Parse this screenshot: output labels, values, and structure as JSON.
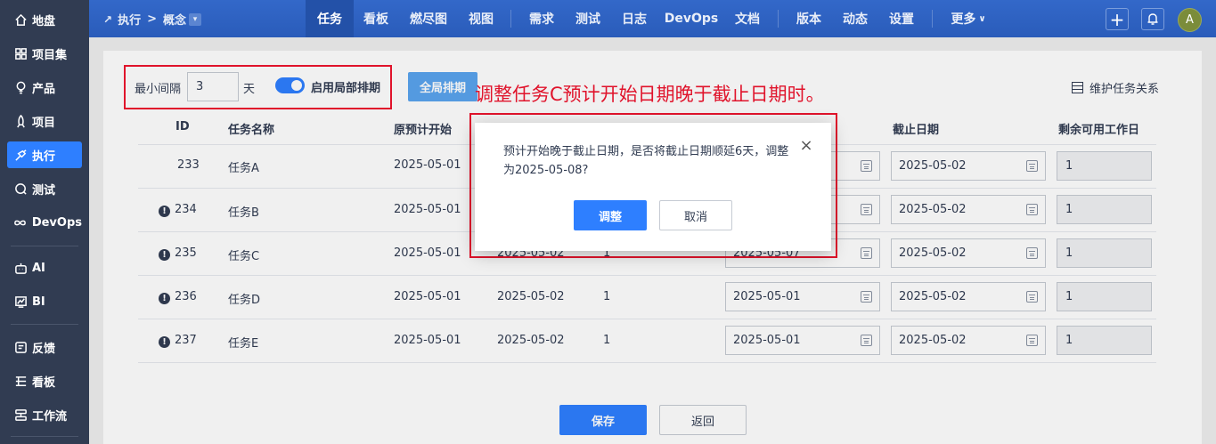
{
  "sidebar": {
    "items": [
      {
        "label": "地盘",
        "icon": "home-icon"
      },
      {
        "label": "项目集",
        "icon": "grid-icon"
      },
      {
        "label": "产品",
        "icon": "bulb-icon"
      },
      {
        "label": "项目",
        "icon": "rocket-icon"
      },
      {
        "label": "执行",
        "icon": "run-icon"
      },
      {
        "label": "测试",
        "icon": "test-icon"
      },
      {
        "label": "DevOps",
        "icon": "infinity-icon"
      },
      {
        "label": "AI",
        "icon": "robot-icon"
      },
      {
        "label": "BI",
        "icon": "chart-icon"
      },
      {
        "label": "反馈",
        "icon": "feedback-icon"
      },
      {
        "label": "看板",
        "icon": "board-icon"
      },
      {
        "label": "工作流",
        "icon": "workflow-icon"
      }
    ]
  },
  "topbar": {
    "breadcrumb_section": "执行",
    "breadcrumb_sep": ">",
    "breadcrumb_item": "概念",
    "nav": [
      "任务",
      "看板",
      "燃尽图",
      "视图",
      "需求",
      "测试",
      "日志",
      "DevOps",
      "文档",
      "版本",
      "动态",
      "设置",
      "更多"
    ],
    "avatar_letter": "A"
  },
  "toolbar": {
    "min_gap_label": "最小间隔",
    "min_gap_value": "3",
    "day_unit": "天",
    "local_schedule_label": "启用局部排期",
    "global_schedule_button": "全局排期",
    "maintain_relations": "维护任务关系"
  },
  "annotation": "调整任务C预计开始日期晚于截止日期时。",
  "table": {
    "headers": {
      "id": "ID",
      "name": "任务名称",
      "orig_start": "原预计开始",
      "deadline": "截止日期",
      "remaining": "剩余可用工作日"
    },
    "rows": [
      {
        "id": "233",
        "name": "任务A",
        "orig_start": "2025-05-01",
        "orig_end": "",
        "days": "",
        "start": "",
        "deadline": "2025-05-02",
        "remaining": "1",
        "warn": false
      },
      {
        "id": "234",
        "name": "任务B",
        "orig_start": "2025-05-01",
        "orig_end": "",
        "days": "",
        "start": "",
        "deadline": "2025-05-02",
        "remaining": "1",
        "warn": true
      },
      {
        "id": "235",
        "name": "任务C",
        "orig_start": "2025-05-01",
        "orig_end": "2025-05-02",
        "days": "1",
        "start": "2025-05-07",
        "deadline": "2025-05-02",
        "remaining": "1",
        "warn": true
      },
      {
        "id": "236",
        "name": "任务D",
        "orig_start": "2025-05-01",
        "orig_end": "2025-05-02",
        "days": "1",
        "start": "2025-05-01",
        "deadline": "2025-05-02",
        "remaining": "1",
        "warn": true
      },
      {
        "id": "237",
        "name": "任务E",
        "orig_start": "2025-05-01",
        "orig_end": "2025-05-02",
        "days": "1",
        "start": "2025-05-01",
        "deadline": "2025-05-02",
        "remaining": "1",
        "warn": true
      }
    ]
  },
  "footer": {
    "save": "保存",
    "back": "返回"
  },
  "dialog": {
    "message": "预计开始晚于截止日期，是否将截止日期顺延6天，调整为2025-05-08?",
    "confirm": "调整",
    "cancel": "取消",
    "close_symbol": "×"
  },
  "colors": {
    "primary": "#2e7fff",
    "topbar": "#2e62c2",
    "sidebar": "#313c52",
    "highlight": "#e0132b"
  }
}
